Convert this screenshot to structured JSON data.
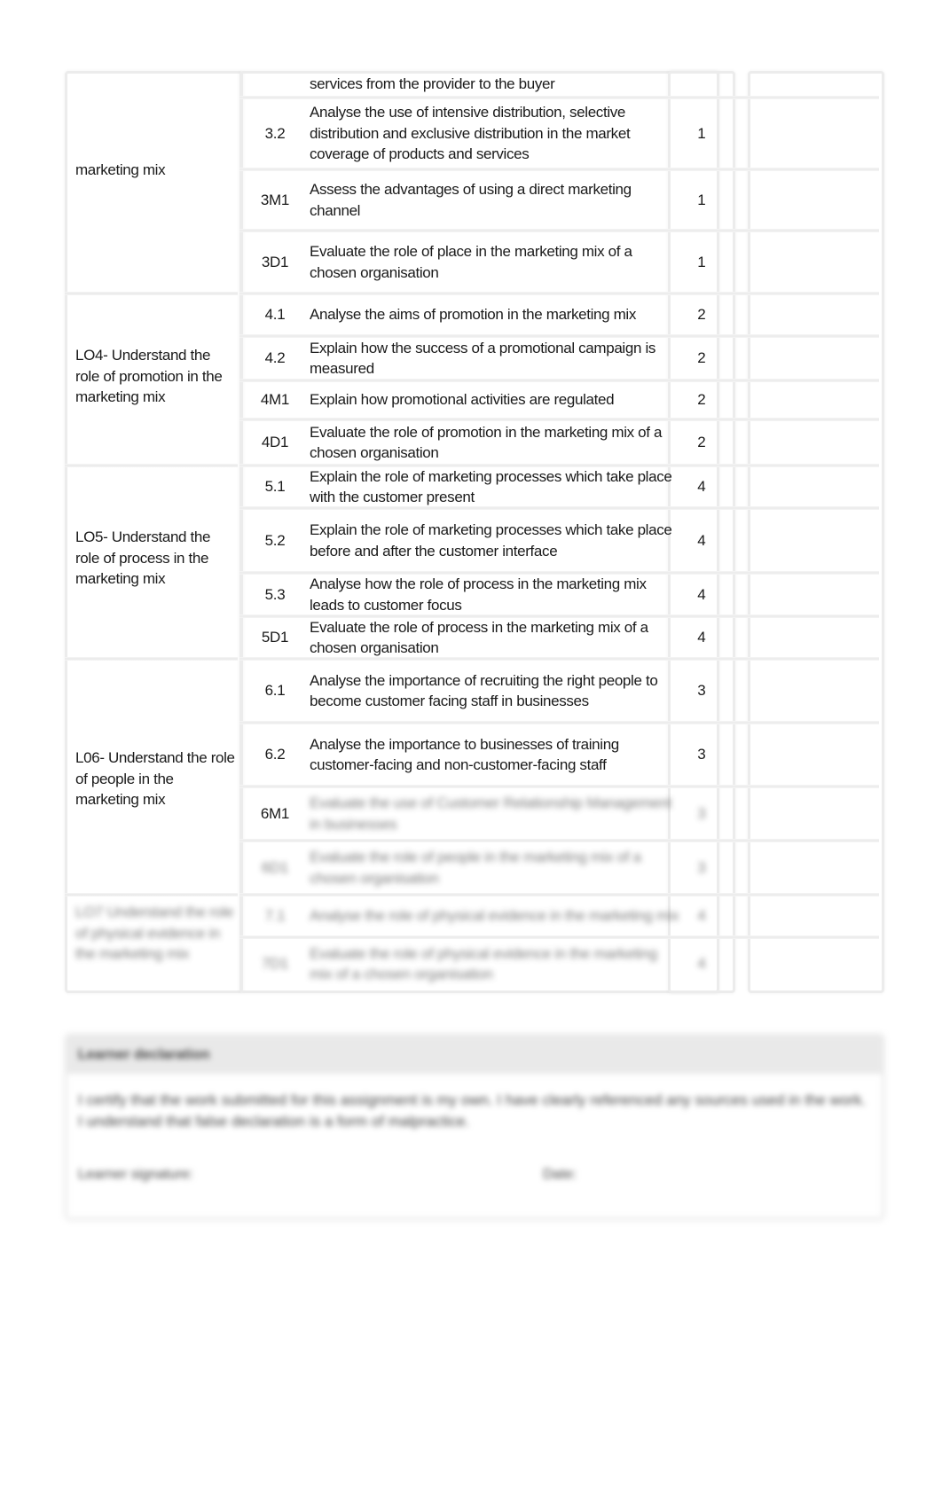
{
  "table": {
    "groups": [
      {
        "label": "marketing mix",
        "blurred": false,
        "rows": [
          {
            "code": "",
            "description": "services from the provider to the buyer",
            "score": "",
            "blurred": false
          },
          {
            "code": "3.2",
            "description": "Analyse the use of intensive distribution, selective distribution and exclusive distribution in the market coverage of products and services",
            "score": "1",
            "blurred": false
          },
          {
            "code": "3M1",
            "description": "Assess the advantages of using a direct marketing channel",
            "score": "1",
            "blurred": false
          },
          {
            "code": "3D1",
            "description": "Evaluate the role of place in the marketing mix of a chosen organisation",
            "score": "1",
            "blurred": false
          }
        ]
      },
      {
        "label": "LO4- Understand the role of promotion in the marketing mix",
        "blurred": false,
        "rows": [
          {
            "code": "4.1",
            "description": "Analyse the aims of promotion in the marketing mix",
            "score": "2",
            "blurred": false
          },
          {
            "code": "4.2",
            "description": "Explain how the success of a promotional campaign is measured",
            "score": "2",
            "blurred": false
          },
          {
            "code": "4M1",
            "description": "Explain how promotional activities are regulated",
            "score": "2",
            "blurred": false
          },
          {
            "code": "4D1",
            "description": "Evaluate the role of promotion in the marketing mix of a chosen organisation",
            "score": "2",
            "blurred": false
          }
        ]
      },
      {
        "label": "LO5- Understand the role of process in the marketing mix",
        "blurred": false,
        "rows": [
          {
            "code": "5.1",
            "description": "Explain the role of marketing processes which take place with the customer present",
            "score": "4",
            "blurred": false
          },
          {
            "code": "5.2",
            "description": "Explain the role of marketing processes which take place before and after the customer interface",
            "score": "4",
            "blurred": false
          },
          {
            "code": "5.3",
            "description": "Analyse how the role of process in the marketing mix leads to customer focus",
            "score": "4",
            "blurred": false
          },
          {
            "code": "5D1",
            "description": "Evaluate the role of process in the marketing mix of a chosen organisation",
            "score": "4",
            "blurred": false
          }
        ]
      },
      {
        "label": "L06- Understand the role of people in the marketing mix",
        "blurred": false,
        "rows": [
          {
            "code": "6.1",
            "description": "Analyse the importance of recruiting the right people to become customer facing staff in businesses",
            "score": "3",
            "blurred": false
          },
          {
            "code": "6.2",
            "description": "Analyse the importance to businesses of training customer-facing and non-customer-facing staff",
            "score": "3",
            "blurred": false
          },
          {
            "code": "6M1",
            "description": "Evaluate the use of Customer Relationship Management in businesses",
            "score": "3",
            "blurred": true
          },
          {
            "code": "6D1",
            "description": "Evaluate the role of people in the marketing mix of a chosen organisation",
            "score": "3",
            "blurred": true
          }
        ]
      },
      {
        "label": "LO7 Understand the role of physical evidence in the marketing mix",
        "blurred": true,
        "rows": [
          {
            "code": "7.1",
            "description": "Analyse the role of physical evidence in the marketing mix",
            "score": "4",
            "blurred": true
          },
          {
            "code": "7D1",
            "description": "Evaluate the role of physical evidence in the marketing mix of a chosen organisation",
            "score": "4",
            "blurred": true
          }
        ]
      }
    ]
  },
  "declaration": {
    "title": "Learner declaration",
    "text": "I certify that the work submitted for this assignment is my own. I have clearly referenced any sources used in the work. I understand that false declaration is a form of malpractice.",
    "signature_label": "Learner signature:",
    "date_label": "Date:"
  }
}
